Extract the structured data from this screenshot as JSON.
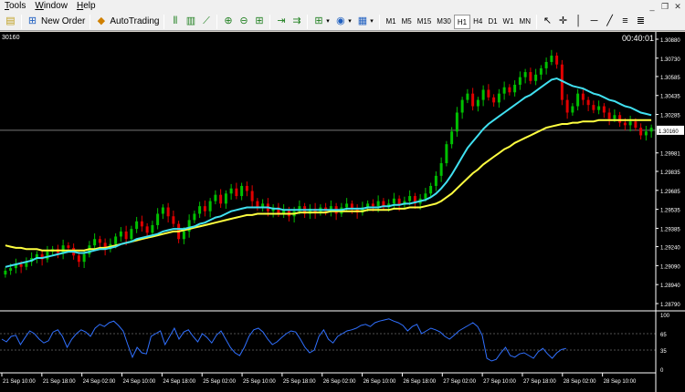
{
  "menu": [
    {
      "label": "Tools",
      "key": "T",
      "rest": "ools"
    },
    {
      "label": "Window",
      "key": "W",
      "rest": "indow"
    },
    {
      "label": "Help",
      "key": "H",
      "rest": "elp"
    }
  ],
  "toolbar": {
    "new_order_label": "New Order",
    "autotrading_label": "AutoTrading",
    "timeframes": [
      "M1",
      "M5",
      "M15",
      "M30",
      "H1",
      "H4",
      "D1",
      "W1",
      "MN"
    ]
  },
  "chart": {
    "symbol_partial": "30160",
    "timer": "00:40:01",
    "current_price_label": "1.30160",
    "price_axis": [
      "1.30880",
      "1.30730",
      "1.30585",
      "1.30435",
      "1.30285",
      "1.29981",
      "1.29835",
      "1.29685",
      "1.29535",
      "1.29385",
      "1.29240",
      "1.29090",
      "1.28940",
      "1.28790"
    ],
    "indicator_axis": [
      "100",
      "65",
      "35",
      "0"
    ],
    "time_axis": [
      "21 Sep 10:00",
      "21 Sep 18:00",
      "24 Sep 02:00",
      "24 Sep 10:00",
      "24 Sep 18:00",
      "25 Sep 02:00",
      "25 Sep 10:00",
      "25 Sep 18:00",
      "26 Sep 02:00",
      "26 Sep 10:00",
      "26 Sep 18:00",
      "27 Sep 02:00",
      "27 Sep 10:00",
      "27 Sep 18:00",
      "28 Sep 02:00",
      "28 Sep 10:00"
    ],
    "colors": {
      "bull": "#00c000",
      "bear": "#e00000",
      "ma_fast": "#40e0f0",
      "ma_slow": "#ffff40",
      "indicator": "#3070ff",
      "bg": "#000000",
      "axis_text": "#ffffff"
    }
  },
  "chart_data": {
    "type": "candlestick",
    "closes": [
      1.2905,
      1.2907,
      1.291,
      1.2908,
      1.2912,
      1.2915,
      1.2918,
      1.2914,
      1.292,
      1.2922,
      1.2919,
      1.2925,
      1.2923,
      1.2917,
      1.2912,
      1.2918,
      1.2925,
      1.293,
      1.2927,
      1.2922,
      1.2926,
      1.2932,
      1.2936,
      1.293,
      1.2938,
      1.2944,
      1.294,
      1.2935,
      1.2941,
      1.295,
      1.2955,
      1.2948,
      1.2942,
      1.293,
      1.2936,
      1.2945,
      1.295,
      1.2956,
      1.2952,
      1.296,
      1.2965,
      1.2958,
      1.2966,
      1.297,
      1.2964,
      1.2972,
      1.2968,
      1.296,
      1.2955,
      1.2958,
      1.2952,
      1.2955,
      1.295,
      1.2953,
      1.2948,
      1.2952,
      1.2956,
      1.295,
      1.2954,
      1.2951,
      1.2955,
      1.2952,
      1.2956,
      1.295,
      1.2955,
      1.2958,
      1.2954,
      1.2951,
      1.2955,
      1.2958,
      1.2956,
      1.296,
      1.2955,
      1.2958,
      1.2962,
      1.2957,
      1.296,
      1.2964,
      1.2958,
      1.2962,
      1.2966,
      1.2972,
      1.298,
      1.299,
      1.3005,
      1.3015,
      1.303,
      1.304,
      1.3045,
      1.3035,
      1.304,
      1.3048,
      1.3042,
      1.3038,
      1.3045,
      1.305,
      1.3046,
      1.3052,
      1.3058,
      1.3062,
      1.3055,
      1.306,
      1.3065,
      1.307,
      1.3075,
      1.3068,
      1.304,
      1.303,
      1.3035,
      1.3045,
      1.304,
      1.3036,
      1.3032,
      1.3035,
      1.303,
      1.3025,
      1.3028,
      1.3022,
      1.302,
      1.3023,
      1.3018,
      1.3012,
      1.3015,
      1.3018
    ],
    "ma_fast": [
      1.2908,
      1.2909,
      1.291,
      1.2911,
      1.2912,
      1.2913,
      1.2915,
      1.2915,
      1.2916,
      1.2917,
      1.2918,
      1.2919,
      1.292,
      1.292,
      1.2919,
      1.2919,
      1.292,
      1.2921,
      1.2922,
      1.2922,
      1.2923,
      1.2924,
      1.2926,
      1.2927,
      1.2928,
      1.293,
      1.2931,
      1.2932,
      1.2933,
      1.2934,
      1.2936,
      1.2937,
      1.2938,
      1.2938,
      1.2938,
      1.2939,
      1.294,
      1.2942,
      1.2943,
      1.2945,
      1.2947,
      1.2948,
      1.295,
      1.2952,
      1.2953,
      1.2954,
      1.2955,
      1.2955,
      1.2955,
      1.2955,
      1.2955,
      1.2954,
      1.2954,
      1.2953,
      1.2953,
      1.2953,
      1.2953,
      1.2953,
      1.2953,
      1.2953,
      1.2953,
      1.2953,
      1.2953,
      1.2953,
      1.2953,
      1.2954,
      1.2954,
      1.2954,
      1.2954,
      1.2955,
      1.2955,
      1.2955,
      1.2956,
      1.2956,
      1.2957,
      1.2957,
      1.2958,
      1.2958,
      1.2959,
      1.296,
      1.2961,
      1.2963,
      1.2966,
      1.297,
      1.2975,
      1.2981,
      1.2988,
      1.2995,
      1.3002,
      1.3007,
      1.3012,
      1.3017,
      1.3021,
      1.3024,
      1.3027,
      1.303,
      1.3033,
      1.3036,
      1.3039,
      1.3042,
      1.3044,
      1.3047,
      1.305,
      1.3053,
      1.3056,
      1.3057,
      1.3055,
      1.3053,
      1.3051,
      1.305,
      1.3049,
      1.3047,
      1.3045,
      1.3044,
      1.3042,
      1.304,
      1.3039,
      1.3037,
      1.3035,
      1.3034,
      1.3032,
      1.303,
      1.3029,
      1.3028
    ],
    "ma_slow": [
      1.2925,
      1.2924,
      1.2923,
      1.2923,
      1.2922,
      1.2922,
      1.2922,
      1.2921,
      1.2921,
      1.2921,
      1.2921,
      1.2921,
      1.2921,
      1.2921,
      1.2921,
      1.2921,
      1.2922,
      1.2922,
      1.2923,
      1.2923,
      1.2924,
      1.2925,
      1.2926,
      1.2927,
      1.2928,
      1.2929,
      1.293,
      1.2931,
      1.2932,
      1.2933,
      1.2934,
      1.2935,
      1.2936,
      1.2936,
      1.2937,
      1.2938,
      1.2939,
      1.294,
      1.2941,
      1.2942,
      1.2943,
      1.2944,
      1.2945,
      1.2946,
      1.2947,
      1.2948,
      1.2949,
      1.2949,
      1.295,
      1.295,
      1.295,
      1.295,
      1.295,
      1.295,
      1.295,
      1.295,
      1.2951,
      1.2951,
      1.2951,
      1.2951,
      1.2951,
      1.2951,
      1.2952,
      1.2952,
      1.2952,
      1.2952,
      1.2952,
      1.2952,
      1.2952,
      1.2953,
      1.2953,
      1.2953,
      1.2953,
      1.2953,
      1.2954,
      1.2954,
      1.2954,
      1.2955,
      1.2955,
      1.2955,
      1.2956,
      1.2957,
      1.2958,
      1.296,
      1.2963,
      1.2966,
      1.297,
      1.2974,
      1.2978,
      1.2982,
      1.2985,
      1.2989,
      1.2992,
      1.2995,
      1.2998,
      1.3001,
      1.3003,
      1.3006,
      1.3008,
      1.301,
      1.3012,
      1.3014,
      1.3016,
      1.3018,
      1.3019,
      1.302,
      1.3021,
      1.3021,
      1.3022,
      1.3022,
      1.3023,
      1.3023,
      1.3023,
      1.3024,
      1.3024,
      1.3024,
      1.3024,
      1.3024,
      1.3024,
      1.3024,
      1.3024,
      1.3024,
      1.3024,
      1.3024
    ],
    "indicator": [
      55,
      50,
      60,
      62,
      45,
      58,
      70,
      65,
      55,
      48,
      52,
      68,
      72,
      60,
      40,
      55,
      65,
      72,
      68,
      60,
      75,
      82,
      78,
      85,
      88,
      80,
      70,
      45,
      22,
      40,
      30,
      28,
      60,
      65,
      70,
      45,
      60,
      75,
      55,
      68,
      72,
      60,
      50,
      65,
      58,
      48,
      62,
      70,
      55,
      40,
      30,
      25,
      40,
      60,
      72,
      75,
      68,
      55,
      45,
      50,
      58,
      65,
      70,
      68,
      55,
      40,
      30,
      35,
      60,
      72,
      55,
      48,
      60,
      65,
      70,
      72,
      75,
      80,
      82,
      78,
      85,
      88,
      90,
      92,
      88,
      85,
      80,
      70,
      78,
      82,
      65,
      70,
      75,
      72,
      68,
      60,
      55,
      62,
      70,
      75,
      80,
      85,
      78,
      62,
      20,
      15,
      18,
      30,
      40,
      25,
      22,
      28,
      30,
      25,
      20,
      32,
      38,
      28,
      20,
      30,
      36,
      38
    ]
  }
}
